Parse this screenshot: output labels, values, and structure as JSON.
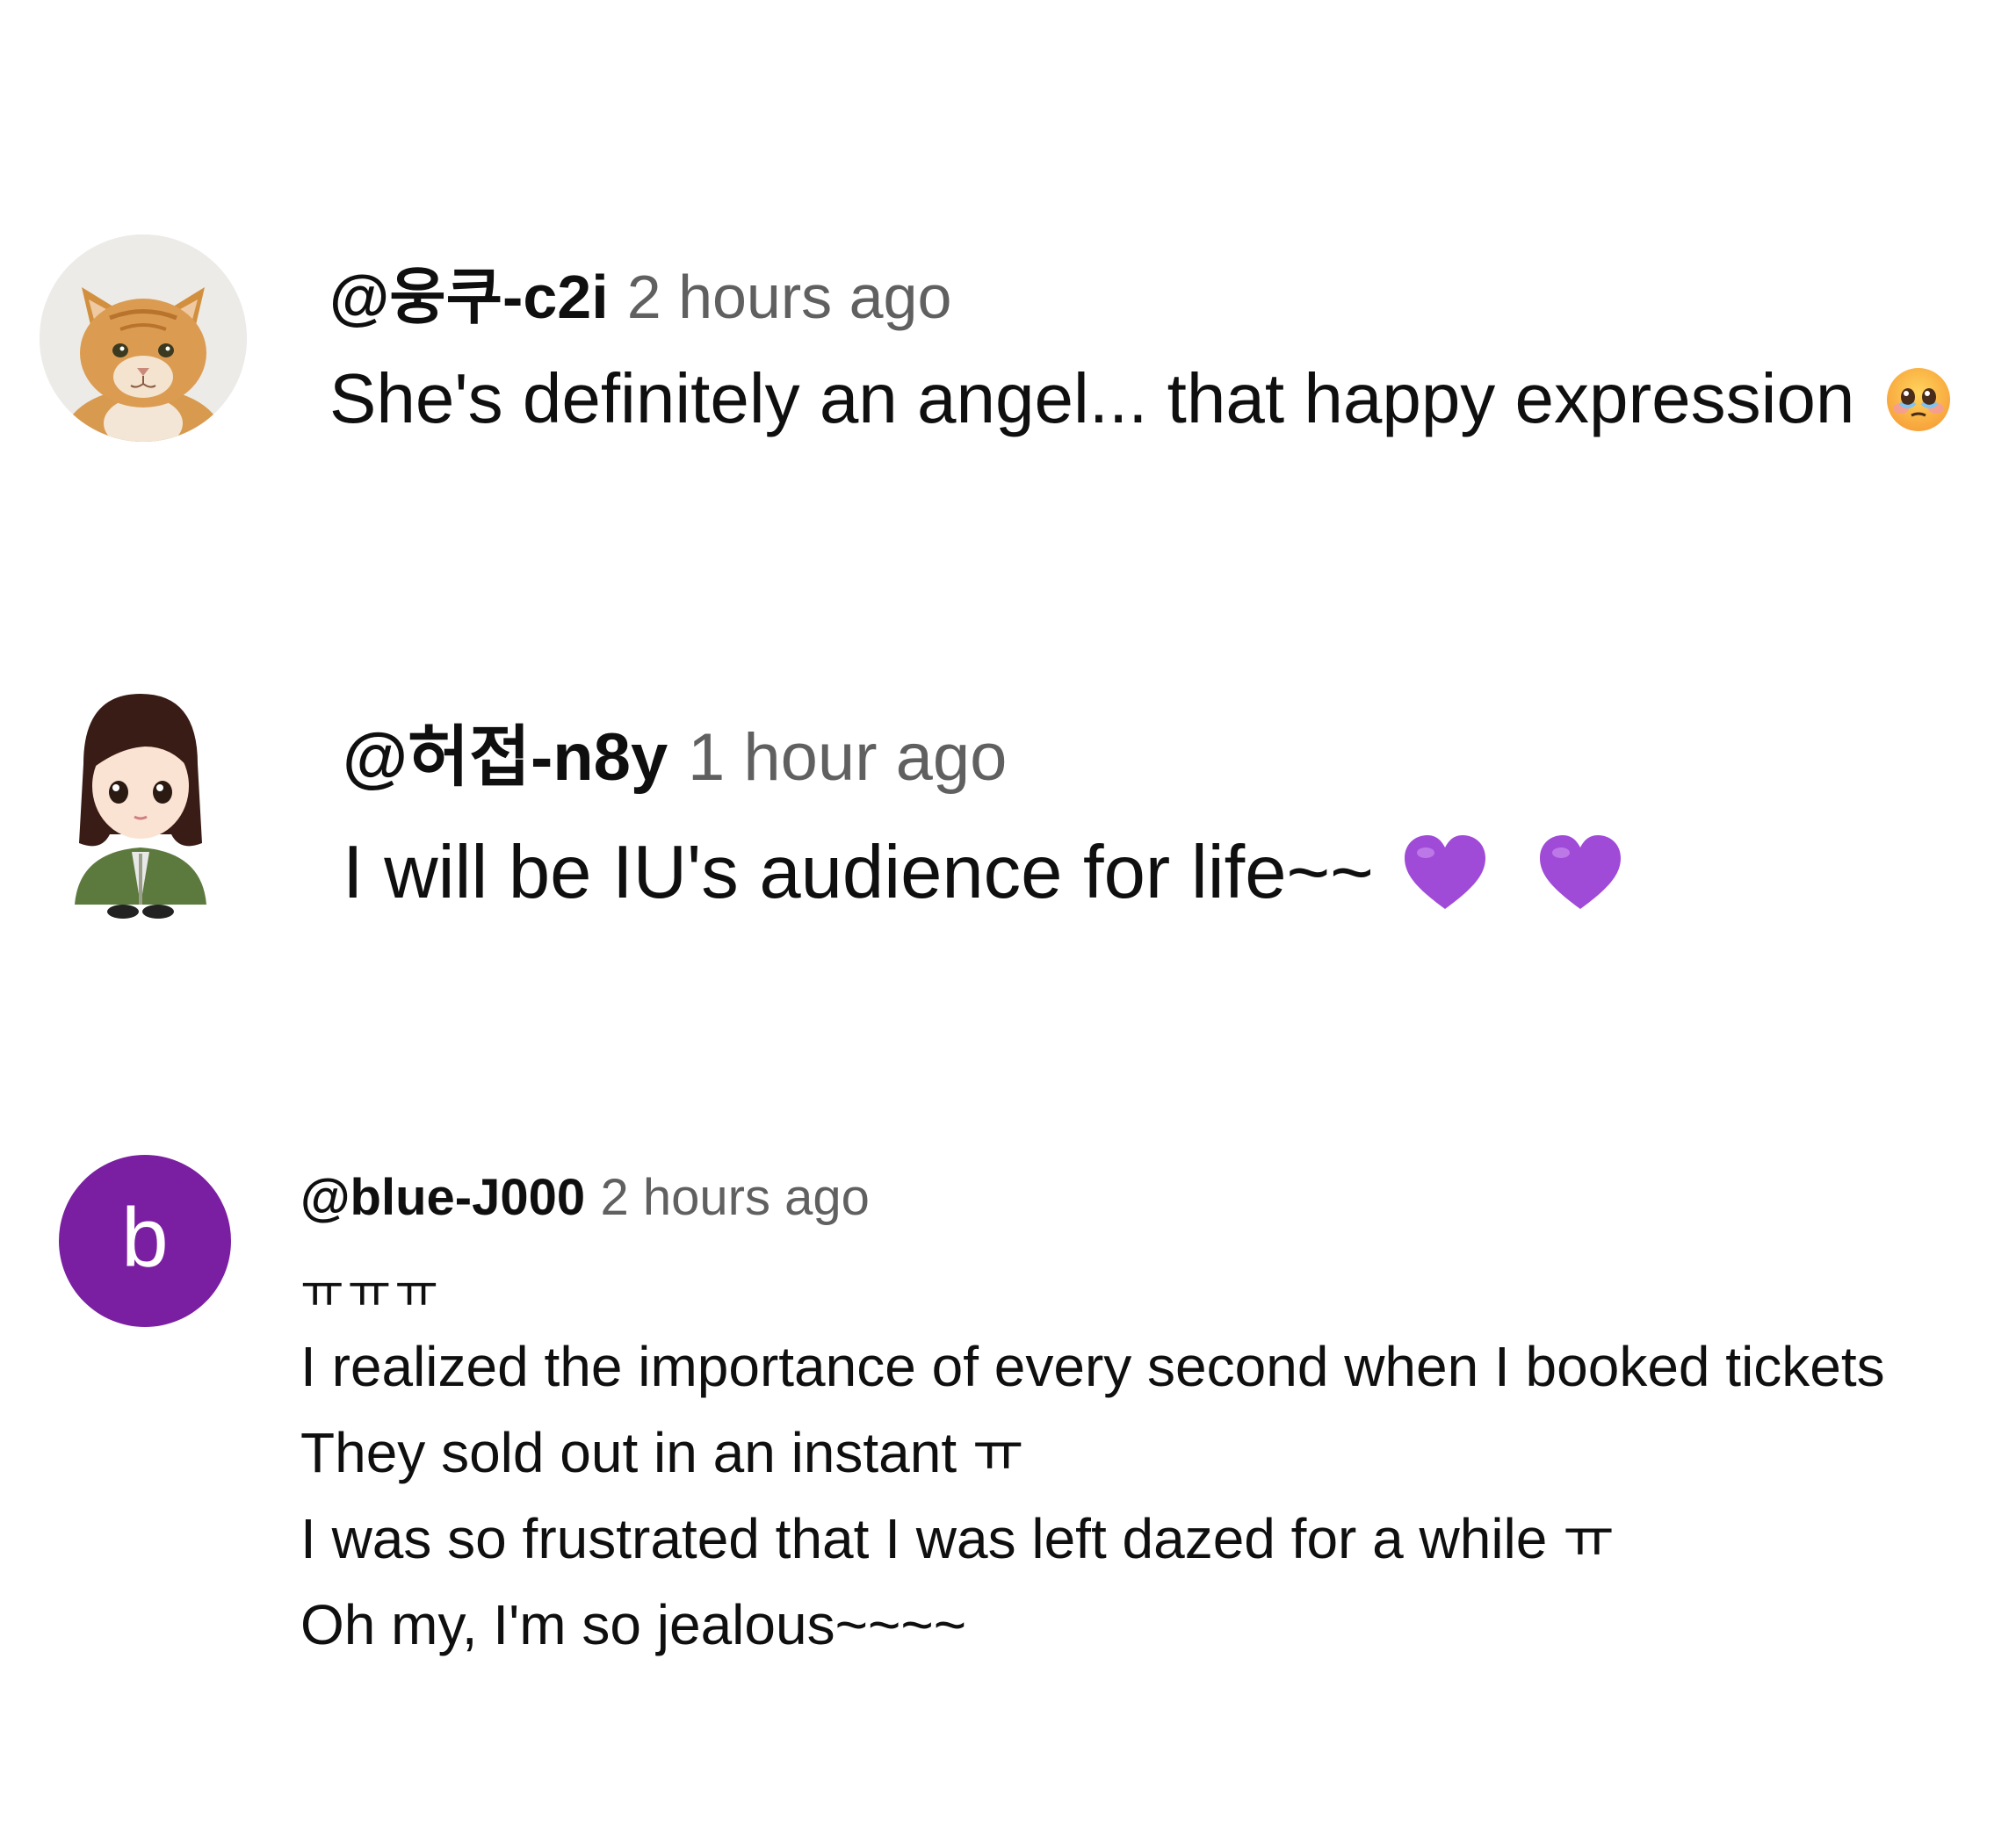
{
  "comments": [
    {
      "author": "@웅쿠-c2i",
      "time": "2 hours ago",
      "text": "She's definitely an angel... that happy expression",
      "emoji": "face-holding-back-tears"
    },
    {
      "author": "@허접-n8y",
      "time": "1 hour ago",
      "text": "I will be IU's audience for life~~",
      "emoji": "purple-heart"
    },
    {
      "author": "@blue-J000",
      "time": "2 hours ago",
      "avatar_letter": "b",
      "avatar_color": "#7b1fa2",
      "lines": [
        "ㅠㅠㅠ",
        "I realized the importance of every second when I booked tickets",
        "They sold out in an instant ㅠ",
        "I was so frustrated that I was left dazed for a while ㅠ",
        "Oh my, I'm so jealous~~~~"
      ]
    }
  ]
}
